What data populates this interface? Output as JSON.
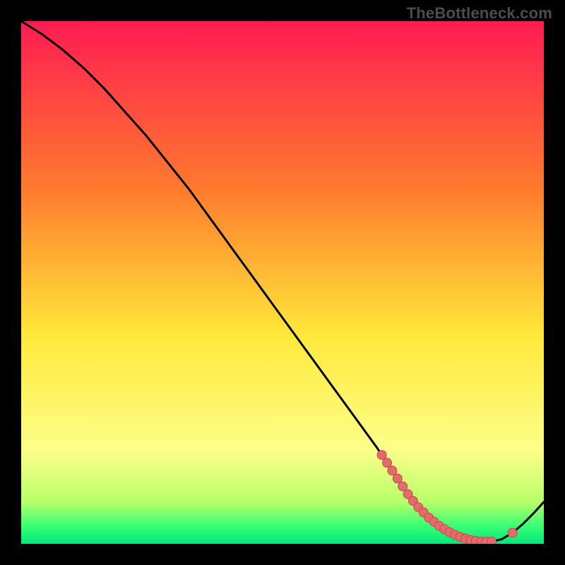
{
  "watermark": "TheBottleneck.com",
  "palette": {
    "bg": "#000000",
    "curve": "#000000",
    "marker_fill": "#e36b6b",
    "marker_stroke": "#c74a4a",
    "gradient_top": "#ff1b52",
    "gradient_mid1": "#ff7a2e",
    "gradient_mid2": "#ffe83a",
    "gradient_low": "#fdff8a",
    "gradient_green1": "#b8ff6a",
    "gradient_green2": "#3cff74",
    "gradient_green3": "#00e87c"
  },
  "chart_data": {
    "type": "line",
    "title": "",
    "xlabel": "",
    "ylabel": "",
    "xlim": [
      0,
      100
    ],
    "ylim": [
      0,
      100
    ],
    "series": [
      {
        "name": "curve",
        "x": [
          0,
          4,
          8,
          12,
          16,
          20,
          24,
          28,
          32,
          36,
          40,
          44,
          48,
          52,
          56,
          60,
          64,
          68,
          70,
          72,
          74,
          76,
          78,
          80,
          82,
          84,
          86,
          88,
          90,
          92,
          94,
          96,
          98,
          100
        ],
        "y": [
          100,
          97.5,
          94.5,
          91,
          87,
          82.5,
          78,
          73,
          68,
          62.5,
          57,
          51.5,
          46,
          40.5,
          35,
          29.5,
          24,
          18.5,
          15.5,
          12.5,
          9.5,
          7,
          5,
          3.4,
          2.2,
          1.3,
          0.7,
          0.4,
          0.4,
          0.9,
          2.1,
          3.8,
          5.8,
          8
        ]
      }
    ],
    "markers": {
      "name": "highlight-points",
      "x": [
        69,
        70,
        71,
        72,
        73,
        74,
        75,
        76,
        77,
        78,
        79,
        80,
        81,
        82,
        83,
        84,
        85,
        86,
        87,
        88,
        89,
        90,
        94
      ],
      "y": [
        17,
        15.5,
        14,
        12.5,
        11,
        9.5,
        8.2,
        7,
        6,
        5,
        4.2,
        3.4,
        2.8,
        2.2,
        1.7,
        1.3,
        1.0,
        0.7,
        0.55,
        0.4,
        0.4,
        0.4,
        2.1
      ]
    },
    "band_stops": [
      {
        "offset": 0.0,
        "key": "gradient_top"
      },
      {
        "offset": 0.32,
        "key": "gradient_mid1"
      },
      {
        "offset": 0.6,
        "key": "gradient_mid2"
      },
      {
        "offset": 0.82,
        "key": "gradient_low"
      },
      {
        "offset": 0.92,
        "key": "gradient_green1"
      },
      {
        "offset": 0.965,
        "key": "gradient_green2"
      },
      {
        "offset": 1.0,
        "key": "gradient_green3"
      }
    ]
  }
}
